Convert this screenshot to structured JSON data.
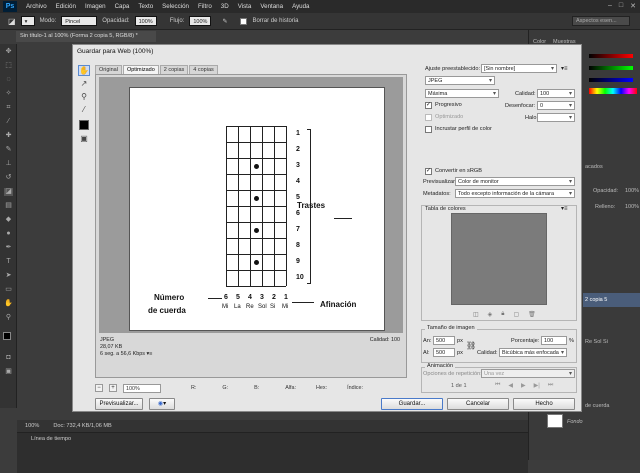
{
  "menubar": {
    "logo": "Ps",
    "items": [
      "Archivo",
      "Edición",
      "Imagen",
      "Capa",
      "Texto",
      "Selección",
      "Filtro",
      "3D",
      "Vista",
      "Ventana",
      "Ayuda"
    ]
  },
  "optionsbar": {
    "mode_label": "Modo:",
    "mode_value": "Pincel",
    "opacity_label": "Opacidad:",
    "opacity_value": "100%",
    "flow_label": "Flujo:",
    "flow_value": "100%",
    "history_label": "Borrar de historia"
  },
  "search": {
    "value": "Aspectos esen..."
  },
  "document_tab": "Sin título-1 al 100% (Forma 2 copia 5, RGB/8) *",
  "right_panel": {
    "tab_color": "Color",
    "tab_swatches": "Muestras",
    "layers_opacity_label": "Opacidad:",
    "layers_opacity_value": "100%",
    "fill_label": "Relleno:",
    "fill_value": "100%",
    "layer_items": [
      "2 copia 5",
      "Re Sol Si",
      "de cuerda",
      "Fondo"
    ],
    "layers_title_fragment": "acados"
  },
  "statusbar": {
    "zoom": "100%",
    "doc": "Doc: 732,4 KB/1,06 MB"
  },
  "timeline": {
    "title": "Línea de tiempo"
  },
  "dialog": {
    "title": "Guardar para Web (100%)",
    "tabs": [
      "Original",
      "Optimizado",
      "2 copias",
      "4 copias"
    ],
    "active_tab": "Optimizado",
    "info_format": "JPEG",
    "info_size": "28,07 KB",
    "info_time": "6 seg. a 56,6 Kbps",
    "info_quality": "Calidad: 100",
    "zoom_value": "100%",
    "readout": {
      "r": "R:",
      "g": "G:",
      "b": "B:",
      "alpha": "Alfa:",
      "hex": "Hex:",
      "index": "Índice:"
    },
    "btn_preview": "Previsualizar...",
    "btn_save": "Guardar...",
    "btn_cancel": "Cancelar",
    "btn_done": "Hecho",
    "settings": {
      "preset_label": "Ajuste preestablecido:",
      "preset_value": "[Sin nombre]",
      "format_value": "JPEG",
      "quality_level": "Máxima",
      "quality_label": "Calidad:",
      "quality_value": "100",
      "progressive_label": "Progresivo",
      "blur_label": "Desenfocar:",
      "blur_value": "0",
      "optimized_label": "Optimizado",
      "matte_label": "Halo:",
      "icc_label": "Incrustar perfil de color",
      "srgb_label": "Convertir en sRGB",
      "preview_label": "Previsualizar:",
      "preview_value": "Color de monitor",
      "metadata_label": "Metadatos:",
      "metadata_value": "Todo excepto información de la cámara",
      "color_table_label": "Tabla de colores"
    },
    "image_size": {
      "title": "Tamaño de imagen",
      "width_label": "An:",
      "width_value": "500",
      "width_unit": "px",
      "height_label": "Al:",
      "height_value": "500",
      "height_unit": "px",
      "percent_label": "Porcentaje:",
      "percent_value": "100",
      "percent_unit": "%",
      "quality_label": "Calidad:",
      "quality_value": "Bicúbica más enfocada"
    },
    "animation": {
      "title": "Animación",
      "loop_label": "Opciones de repetición:",
      "loop_value": "Una vez",
      "frame_counter": "1 de 1"
    }
  },
  "fretboard": {
    "fret_numbers": [
      "1",
      "2",
      "3",
      "4",
      "5",
      "6",
      "7",
      "8",
      "9",
      "10"
    ],
    "string_numbers": [
      "6",
      "5",
      "4",
      "3",
      "2",
      "1"
    ],
    "string_names": [
      "Mi",
      "La",
      "Re",
      "Sol",
      "Si",
      "Mi"
    ],
    "label_frets": "Trastes",
    "label_string_number": "Número",
    "label_string_number_2": "de cuerda",
    "label_tuning": "Afinación",
    "dots": [
      {
        "string": 3,
        "fret": 3
      },
      {
        "string": 3,
        "fret": 5
      },
      {
        "string": 3,
        "fret": 7
      },
      {
        "string": 3,
        "fret": 9
      },
      {
        "string": 4,
        "fret": 12
      }
    ]
  },
  "colors": {
    "accent": "#31a8ff",
    "dialog_bg": "#e6e6e6",
    "ps_dark": "#3c3c3c"
  }
}
